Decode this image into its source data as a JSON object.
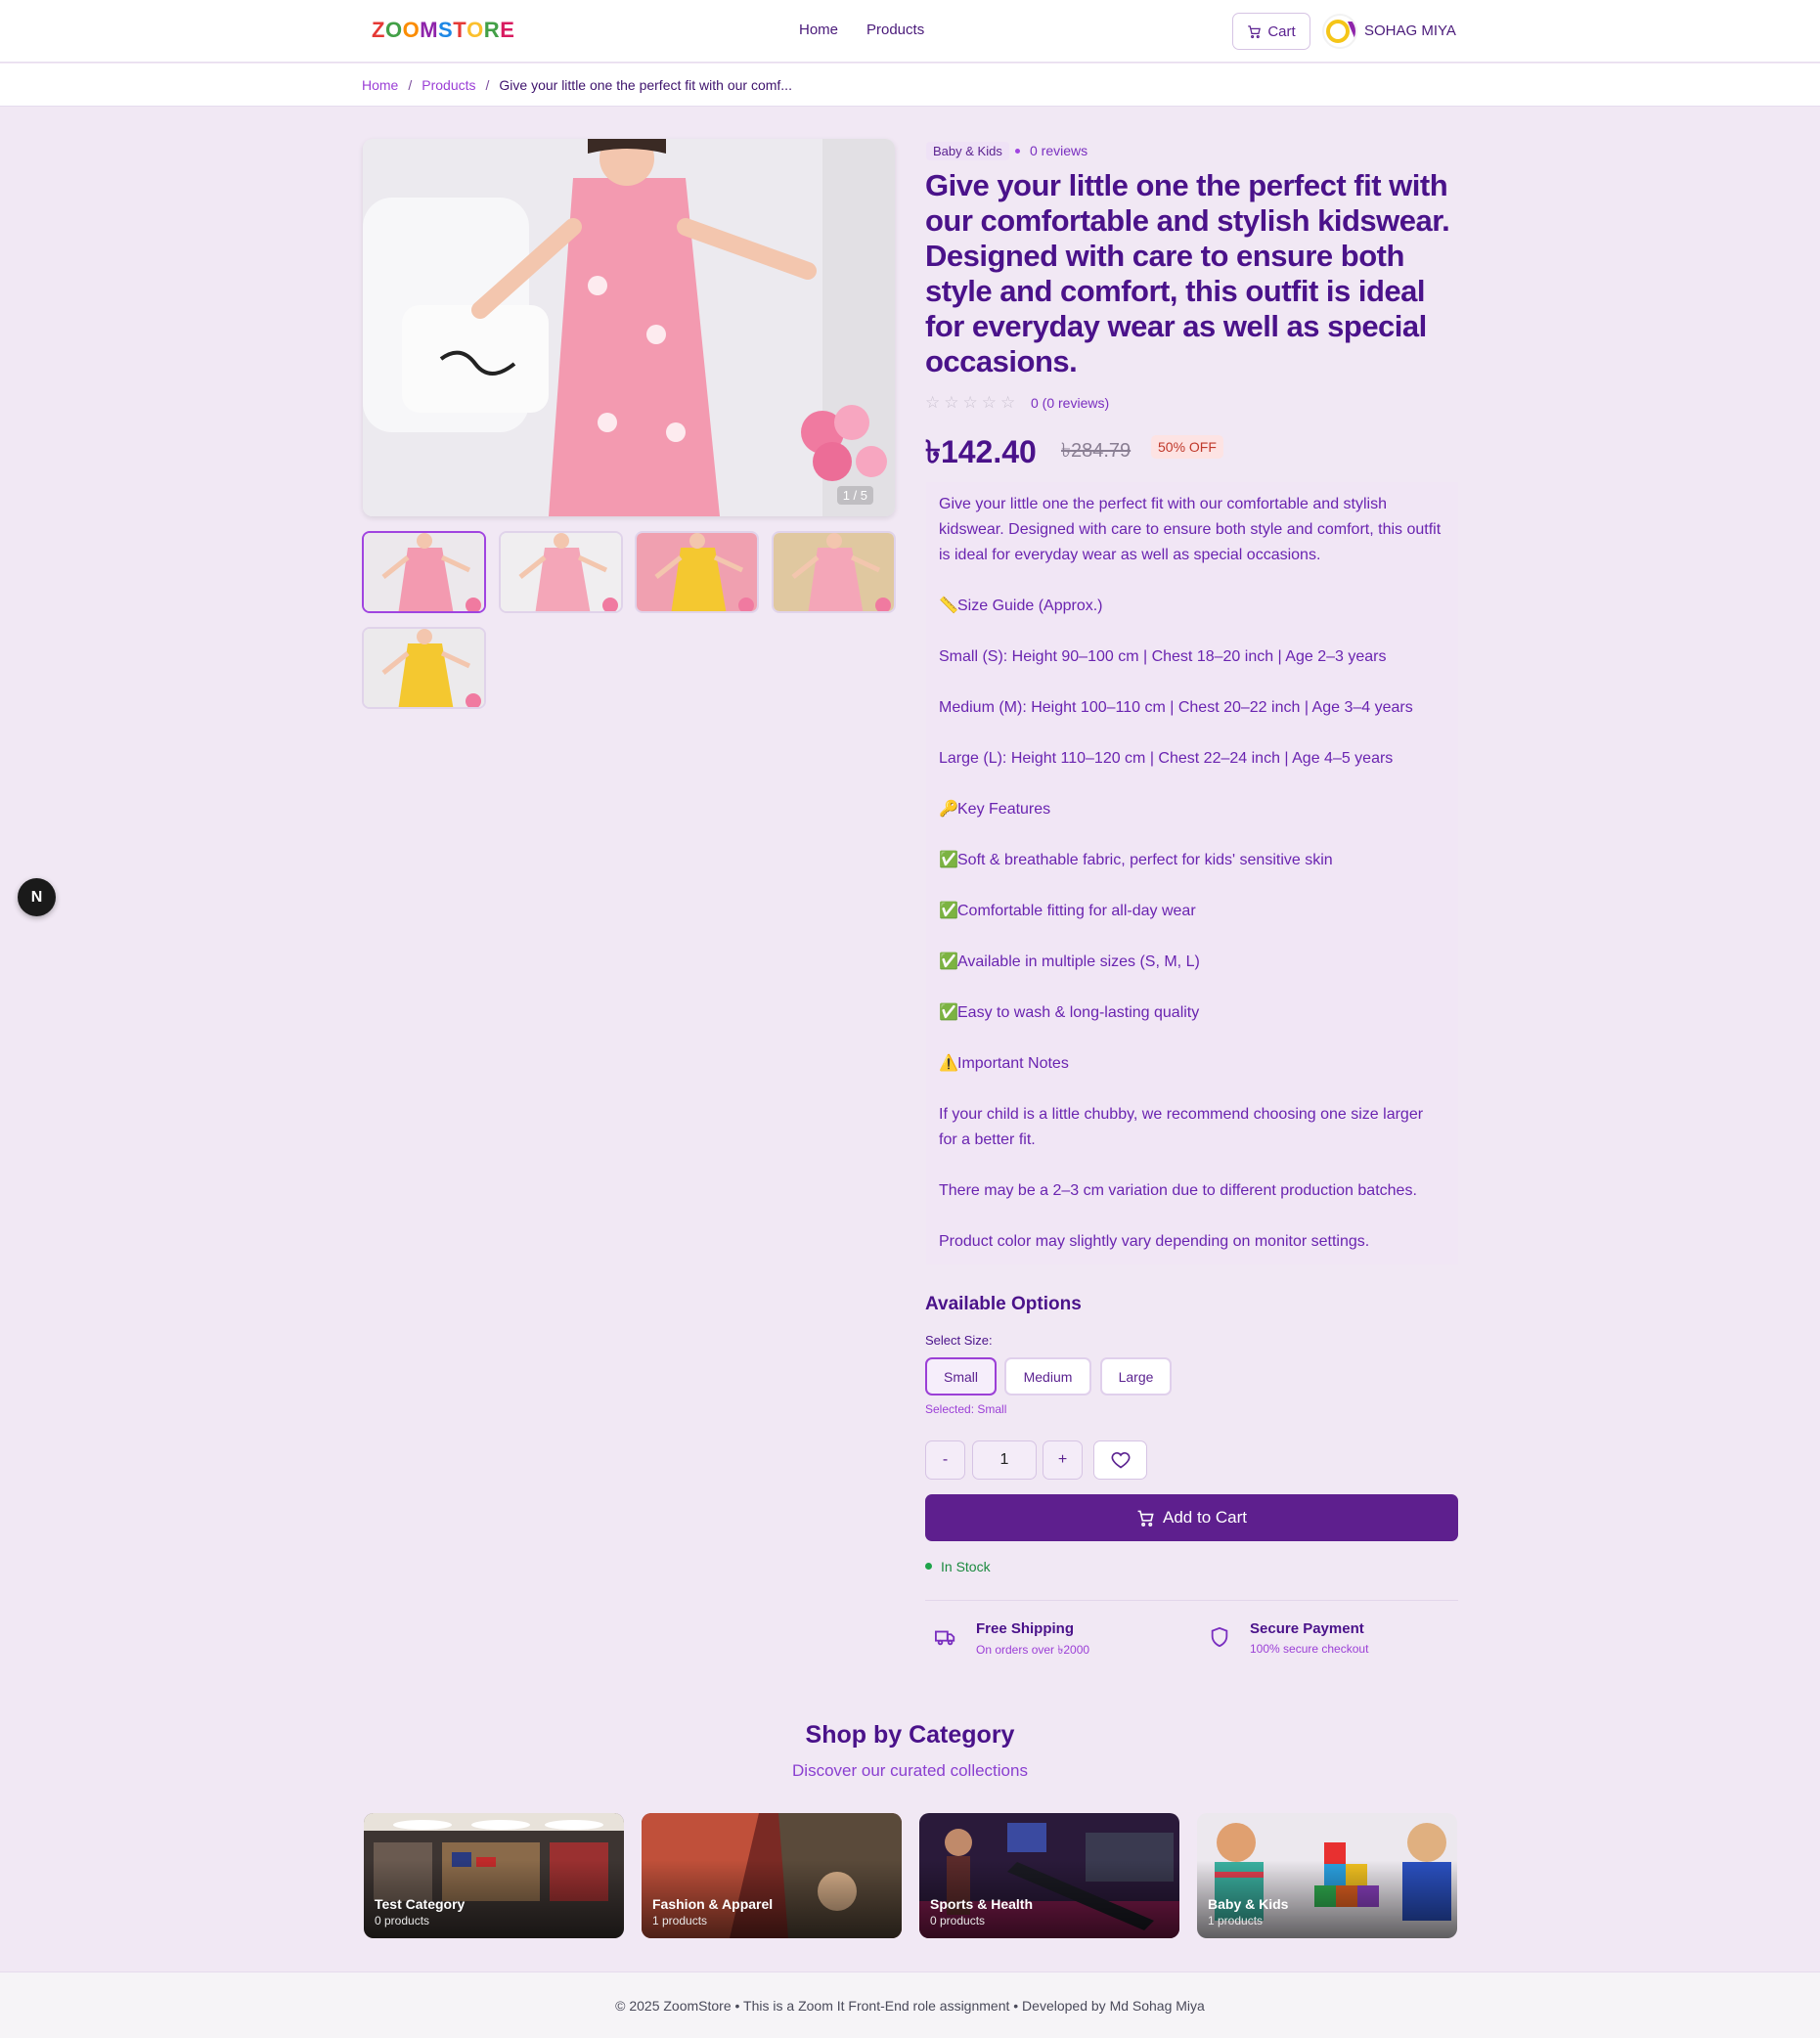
{
  "header": {
    "logo_letters": [
      {
        "ch": "Z",
        "color": "#e53935"
      },
      {
        "ch": "O",
        "color": "#43a047"
      },
      {
        "ch": "O",
        "color": "#fb8c00"
      },
      {
        "ch": "M",
        "color": "#8e24aa"
      },
      {
        "ch": "S",
        "color": "#1e88e5"
      },
      {
        "ch": "T",
        "color": "#e53935"
      },
      {
        "ch": "O",
        "color": "#fbc02d"
      },
      {
        "ch": "R",
        "color": "#43a047"
      },
      {
        "ch": "E",
        "color": "#d81b60"
      }
    ],
    "nav_home": "Home",
    "nav_products": "Products",
    "cart_label": "Cart",
    "user_name": "SOHAG MIYA"
  },
  "breadcrumb": {
    "home": "Home",
    "products": "Products",
    "current": "Give your little one the perfect fit with our comf...",
    "separator": "/"
  },
  "gallery": {
    "counter": "1 / 5",
    "thumb_count": 5,
    "active_index": 0
  },
  "product": {
    "category": "Baby & Kids",
    "reviews_tag": "0 reviews",
    "title": "Give your little one the perfect fit with our comfortable and stylish kidswear. Designed with care to ensure both style and comfort, this outfit is ideal for everyday wear as well as special occasions.",
    "rating_value": 0,
    "rating_text": "0 (0 reviews)",
    "price": "৳142.40",
    "old_price": "৳284.79",
    "discount": "50% OFF",
    "description": [
      {
        "emoji": "",
        "text": "Give your little one the perfect fit with our comfortable and stylish kidswear. Designed with care to ensure both style and comfort, this outfit is ideal for everyday wear as well as special occasions."
      },
      {
        "emoji": "📏",
        "text": "Size Guide (Approx.)"
      },
      {
        "emoji": "",
        "text": "Small (S): Height 90–100 cm | Chest 18–20 inch | Age 2–3 years"
      },
      {
        "emoji": "",
        "text": "Medium (M): Height 100–110 cm | Chest 20–22 inch | Age 3–4 years"
      },
      {
        "emoji": "",
        "text": "Large (L): Height 110–120 cm | Chest 22–24 inch | Age 4–5 years"
      },
      {
        "emoji": "🔑",
        "text": "Key Features"
      },
      {
        "emoji": "✅",
        "text": "Soft & breathable fabric, perfect for kids' sensitive skin"
      },
      {
        "emoji": "✅",
        "text": "Comfortable fitting for all-day wear"
      },
      {
        "emoji": "✅",
        "text": "Available in multiple sizes (S, M, L)"
      },
      {
        "emoji": "✅",
        "text": "Easy to wash & long-lasting quality"
      },
      {
        "emoji": "⚠️",
        "text": "Important Notes"
      },
      {
        "emoji": "",
        "text": "If your child is a little chubby, we recommend choosing one size larger for a better fit."
      },
      {
        "emoji": "",
        "text": "There may be a 2–3 cm variation due to different production batches."
      },
      {
        "emoji": "",
        "text": "Product color may slightly vary depending on monitor settings."
      }
    ]
  },
  "options": {
    "title": "Available Options",
    "select_label": "Select Size:",
    "sizes": [
      "Small",
      "Medium",
      "Large"
    ],
    "selected_size": "Small",
    "selected_note": "Selected: Small",
    "qty_minus": "-",
    "qty_value": "1",
    "qty_plus": "+",
    "add_to_cart": "Add to Cart",
    "stock": "In Stock"
  },
  "features": [
    {
      "icon": "truck-icon",
      "title": "Free Shipping",
      "sub": "On orders over ৳2000"
    },
    {
      "icon": "shield-icon",
      "title": "Secure Payment",
      "sub": "100% secure checkout"
    }
  ],
  "categories_section": {
    "title": "Shop by Category",
    "subtitle": "Discover our curated collections",
    "items": [
      {
        "name": "Test Category",
        "count": "0 products",
        "bg": "#3a3130"
      },
      {
        "name": "Fashion & Apparel",
        "count": "1 products",
        "bg": "#8a3a30"
      },
      {
        "name": "Sports & Health",
        "count": "0 products",
        "bg": "#2a1a3a"
      },
      {
        "name": "Baby & Kids",
        "count": "1 products",
        "bg": "#e8e4ea"
      }
    ]
  },
  "footer": {
    "text": "© 2025 ZoomStore • This is a Zoom It Front-End role assignment • Developed by Md Sohag Miya"
  },
  "dev_badge": "N"
}
